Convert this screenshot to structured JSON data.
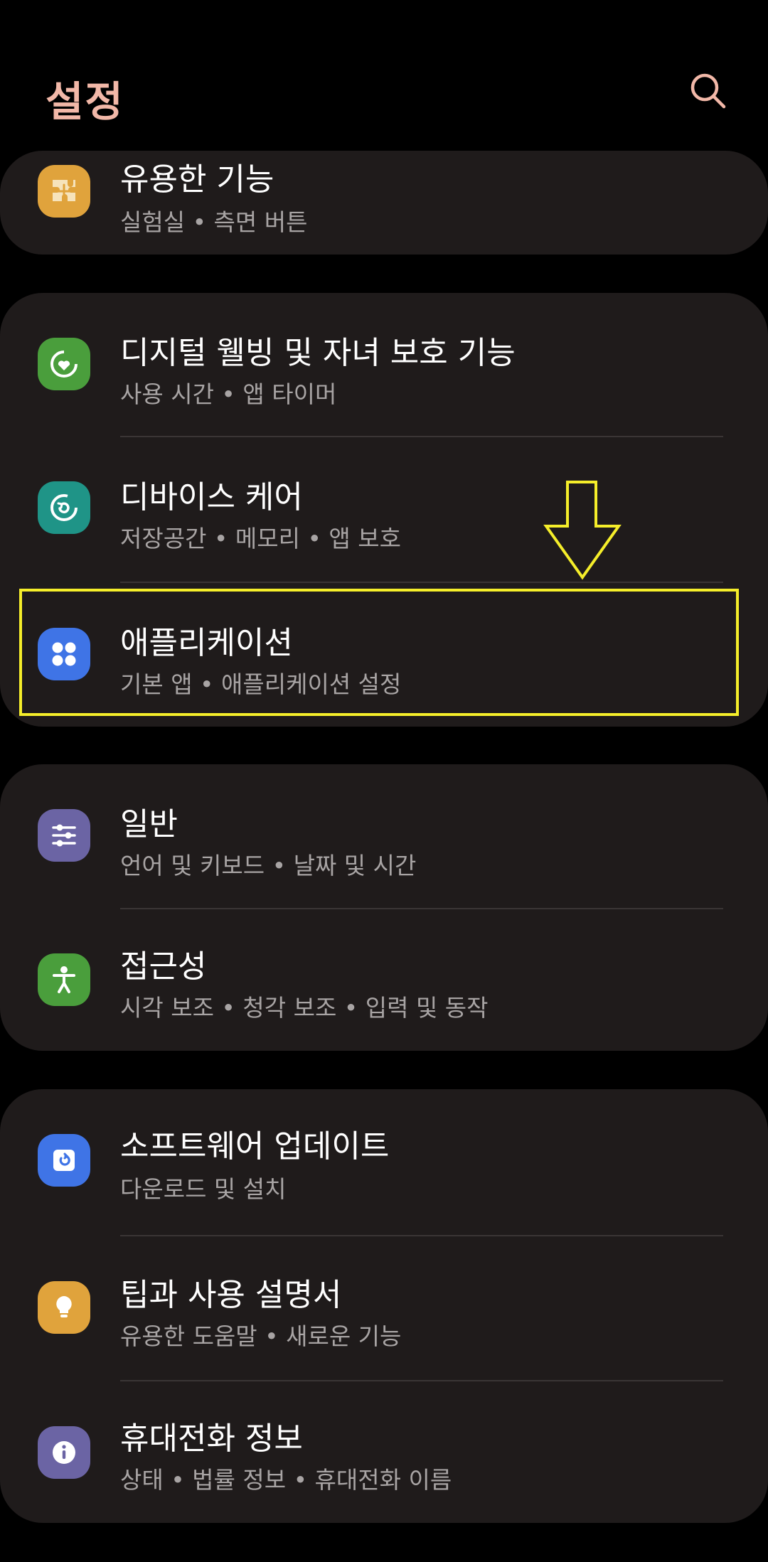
{
  "header": {
    "title": "설정"
  },
  "groups": [
    {
      "items": [
        {
          "title": "유용한 기능",
          "subtitle": "실험실 • 측면 버튼",
          "icon": "puzzle-icon",
          "color": "#e0a33c"
        }
      ]
    },
    {
      "items": [
        {
          "title": "디지털 웰빙 및 자녀 보호 기능",
          "subtitle": "사용 시간 • 앱 타이머",
          "icon": "heart-ring-icon",
          "color": "#4a9e3c"
        },
        {
          "title": "디바이스 케어",
          "subtitle": "저장공간 • 메모리 • 앱 보호",
          "icon": "refresh-icon",
          "color": "#1f9487"
        },
        {
          "title": "애플리케이션",
          "subtitle": "기본 앱 • 애플리케이션 설정",
          "icon": "apps-grid-icon",
          "color": "#3f74e6"
        }
      ]
    },
    {
      "items": [
        {
          "title": "일반",
          "subtitle": "언어 및 키보드 • 날짜 및 시간",
          "icon": "sliders-icon",
          "color": "#6b64a4"
        },
        {
          "title": "접근성",
          "subtitle": "시각 보조 • 청각 보조 • 입력 및 동작",
          "icon": "accessibility-icon",
          "color": "#4a9e3c"
        }
      ]
    },
    {
      "items": [
        {
          "title": "소프트웨어 업데이트",
          "subtitle": "다운로드 및 설치",
          "icon": "update-icon",
          "color": "#3f74e6"
        },
        {
          "title": "팁과 사용 설명서",
          "subtitle": "유용한 도움말 • 새로운 기능",
          "icon": "bulb-icon",
          "color": "#e0a33c"
        },
        {
          "title": "휴대전화 정보",
          "subtitle": "상태 • 법률 정보 • 휴대전화 이름",
          "icon": "info-icon",
          "color": "#6b64a4"
        }
      ]
    }
  ],
  "annotation": {
    "highlight_color": "#f5ee2a"
  }
}
